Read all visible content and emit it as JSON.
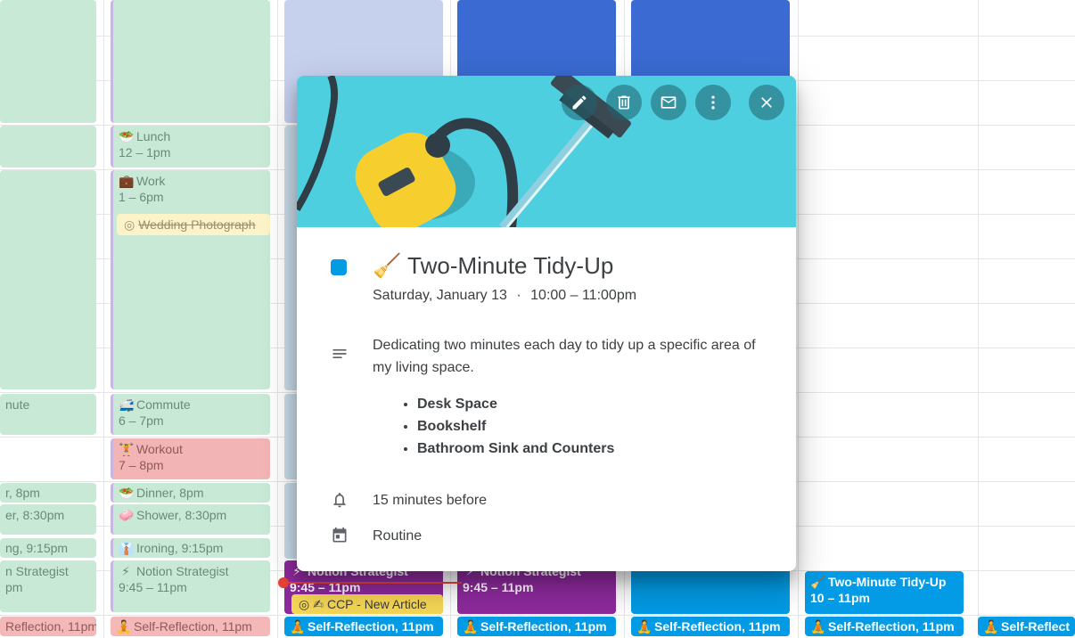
{
  "calendar": {
    "columns": {
      "col1": {
        "commute_title": "nute",
        "dinner_title": "r, 8pm",
        "shower_title": "er, 8:30pm",
        "ironing_title": "ng, 9:15pm",
        "notion_title": "n Strategist",
        "notion_time": "pm",
        "selfref": "Reflection, 11pm"
      },
      "col2": {
        "lunch_title": "Lunch",
        "lunch_time": "12 – 1pm",
        "work_title": "Work",
        "work_time": "1 – 6pm",
        "wedding_chip": "Wedding Photograph",
        "commute_title": "Commute",
        "commute_time": "6 – 7pm",
        "workout_title": "Workout",
        "workout_time": "7 – 8pm",
        "dinner_title": "Dinner",
        "dinner_time": ", 8pm",
        "shower_title": "Shower",
        "shower_time": ", 8:30pm",
        "ironing_title": "Ironing",
        "ironing_time": ", 9:15pm",
        "notion_title": "Notion Strategist",
        "notion_time": "9:45 – 11pm",
        "selfref": "Self-Reflection, 11pm"
      },
      "col3": {
        "notion_title": "Notion Strategist",
        "notion_time": "9:45 – 11pm",
        "ccp_chip": "CCP - New Article",
        "selfref": "Self-Reflection, 11pm"
      },
      "col4": {
        "notion_title": "Notion Strategist",
        "notion_time": "9:45 – 11pm",
        "selfref": "Self-Reflection, 11pm"
      },
      "col5": {
        "selfref": "Self-Reflection, 11pm"
      },
      "col6": {
        "tidy_title": "Two-Minute Tidy-Up",
        "tidy_time": "10 – 11pm",
        "selfref": "Self-Reflection, 11pm"
      },
      "col7": {
        "selfref": "Self-Reflect"
      }
    }
  },
  "popup": {
    "toolbar": [
      "edit-icon",
      "delete-icon",
      "email-icon",
      "more-options-icon",
      "close-icon"
    ],
    "color": "#039be5",
    "emoji": "🧹",
    "title": "Two-Minute Tidy-Up",
    "date": "Saturday, January 13",
    "separator": "·",
    "time": "10:00 – 11:00pm",
    "description": "Dedicating two minutes each day to tidy up a specific area of my living space.",
    "items": [
      "Desk Space",
      "Bookshelf",
      "Bathroom Sink and Counters"
    ],
    "reminder": "15 minutes before",
    "calendar_name": "Routine"
  }
}
